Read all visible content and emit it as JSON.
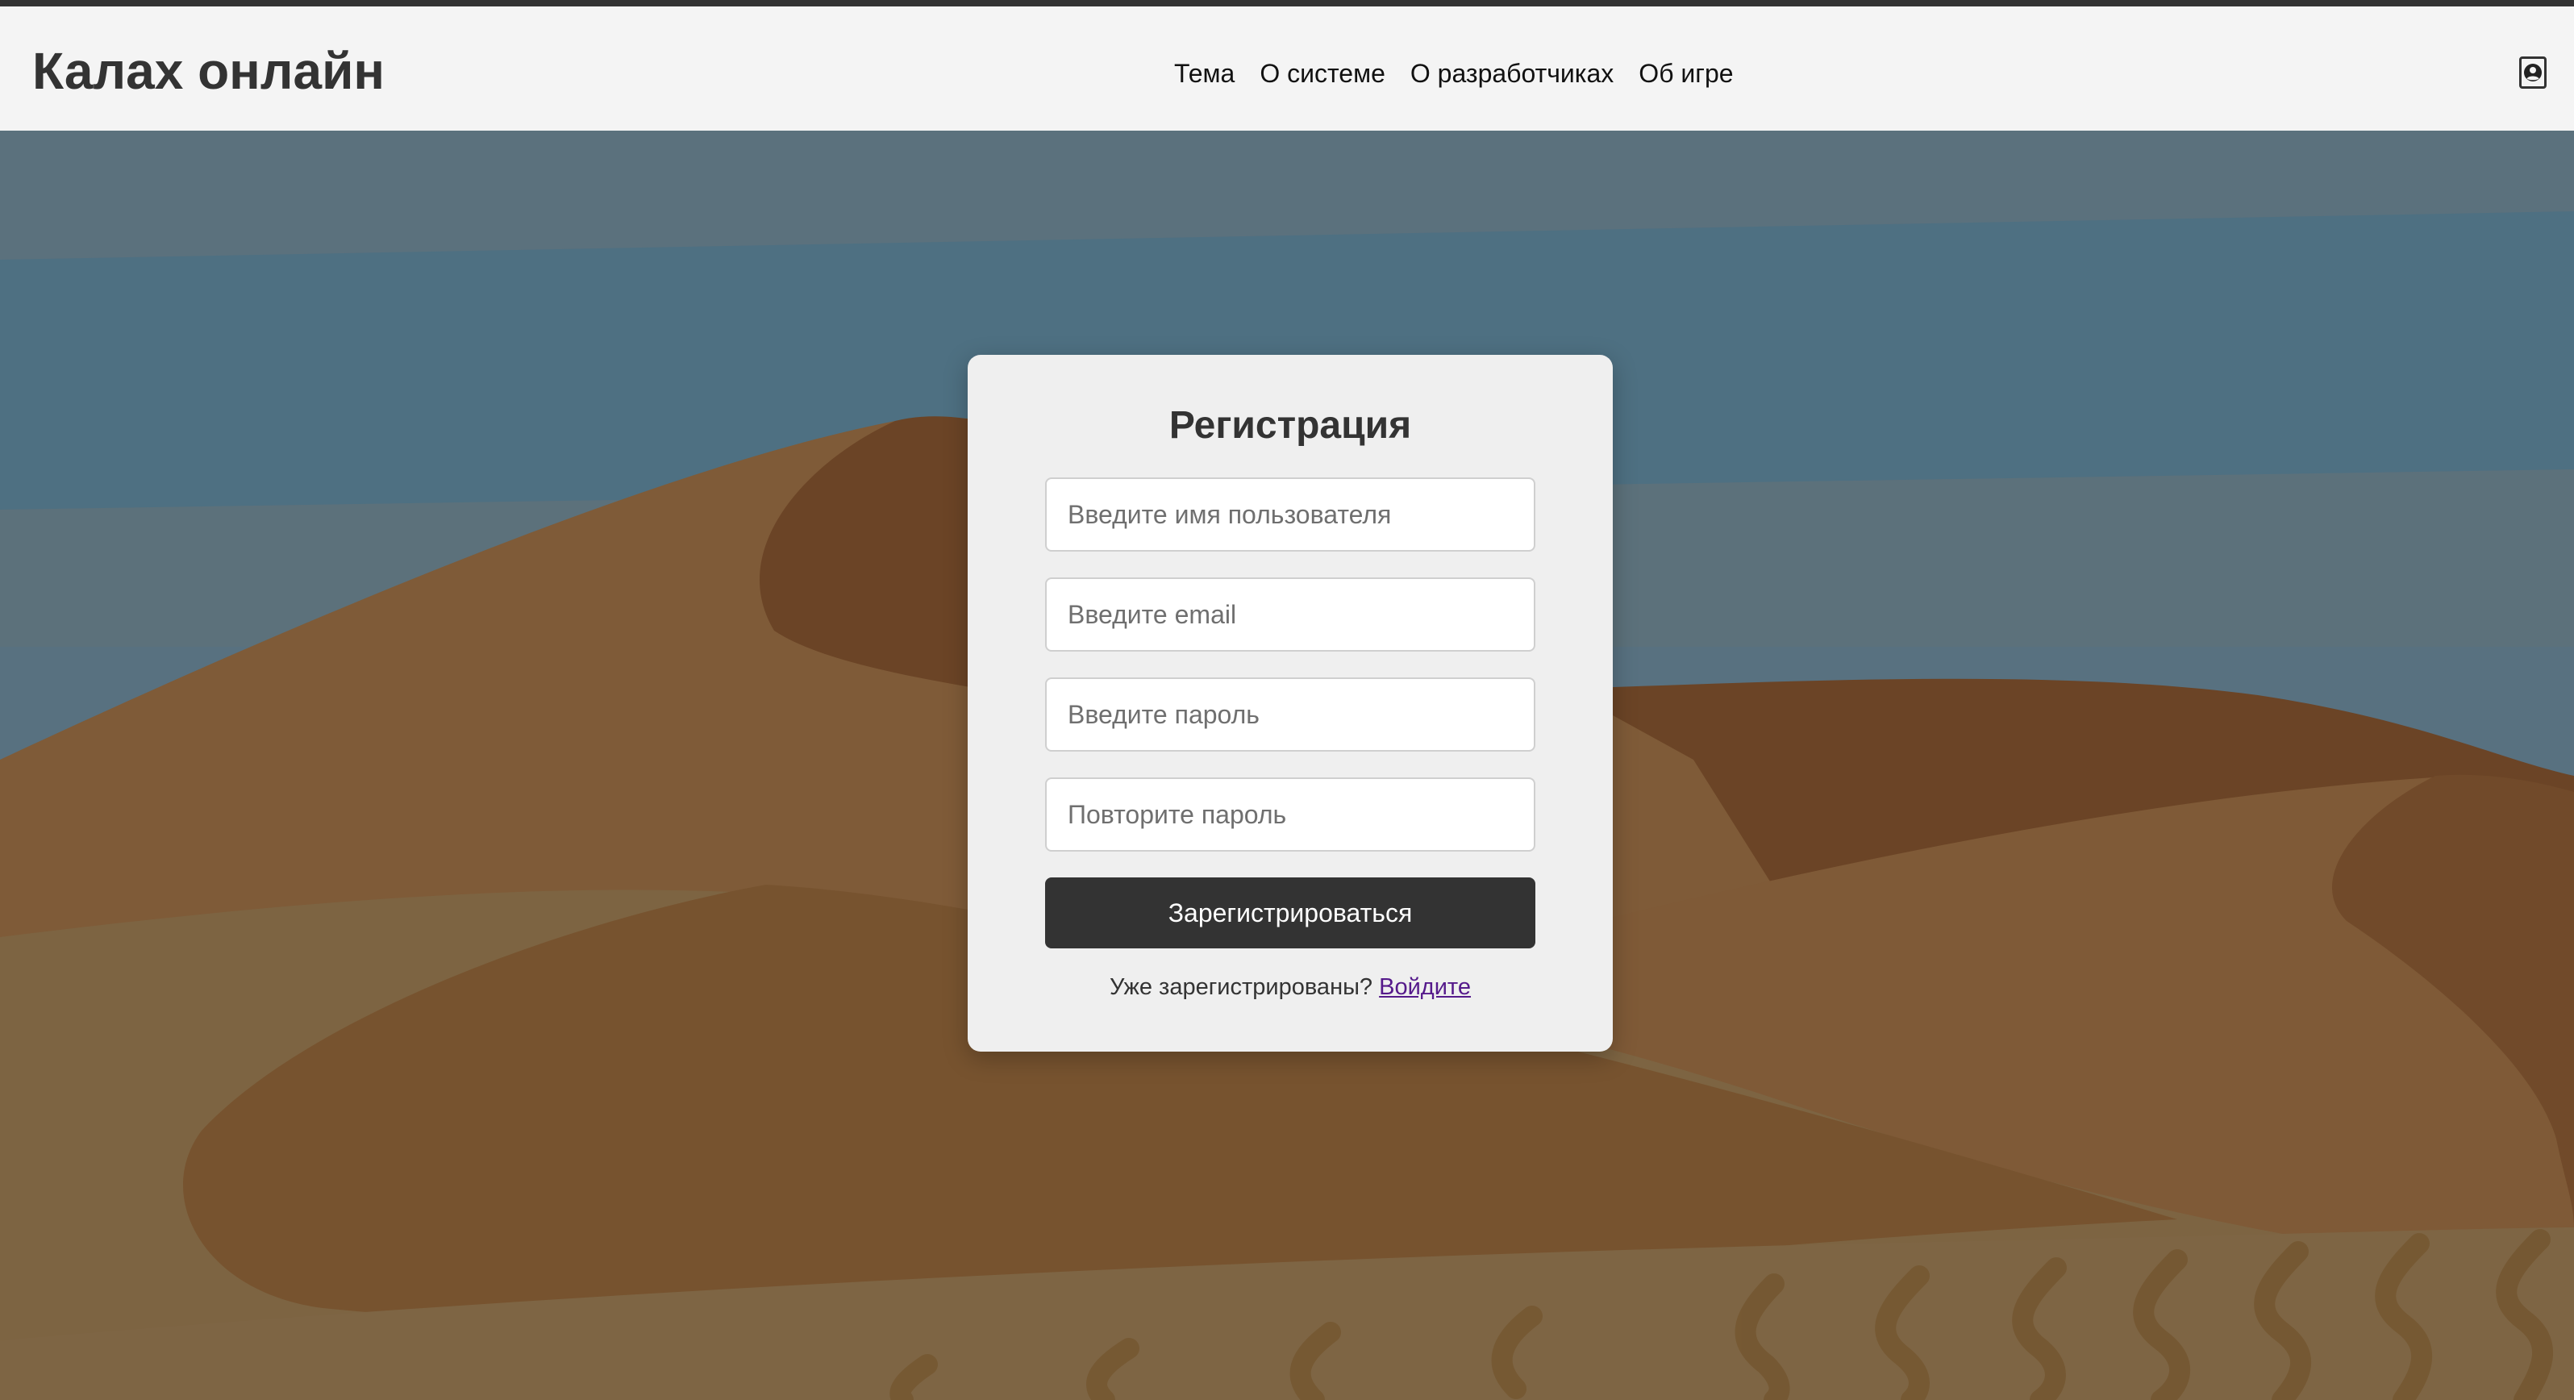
{
  "header": {
    "logo": "Калах онлайн",
    "nav": [
      {
        "label": "Тема"
      },
      {
        "label": "О системе"
      },
      {
        "label": "О разработчиках"
      },
      {
        "label": "Об игре"
      }
    ],
    "profile_icon": "user-circle-icon"
  },
  "form": {
    "title": "Регистрация",
    "username_placeholder": "Введите имя пользователя",
    "email_placeholder": "Введите email",
    "password_placeholder": "Введите пароль",
    "repeat_password_placeholder": "Повторите пароль",
    "submit_label": "Зарегистрироваться",
    "login_prompt": "Уже зарегистрированы?",
    "login_link": "Войдите"
  },
  "colors": {
    "header_bg": "#f4f4f4",
    "accent": "#333333",
    "link": "#551a8b",
    "sky": "#4f7080",
    "dune_dark": "#6b4426",
    "dune_mid": "#7e5a37",
    "dune_light": "#7d6442"
  }
}
